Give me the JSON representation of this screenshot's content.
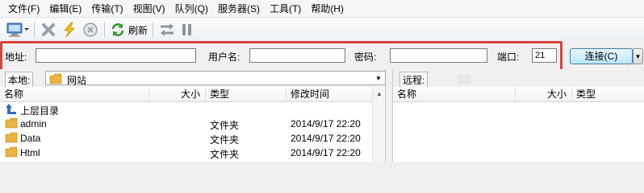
{
  "menu": [
    "文件(F)",
    "编辑(E)",
    "传输(T)",
    "视图(V)",
    "队列(Q)",
    "服务器(S)",
    "工具(T)",
    "帮助(H)"
  ],
  "toolbar": {
    "refresh_label": "刷新"
  },
  "connection": {
    "address_label": "地址:",
    "address_value": "",
    "username_label": "用户名:",
    "username_value": "",
    "password_label": "密码:",
    "password_value": "",
    "port_label": "端口:",
    "port_value": "21",
    "connect_label": "连接(C)",
    "highlight_color": "#d9433c"
  },
  "local": {
    "path_label": "本地:",
    "path_value": "网站",
    "columns": {
      "name": "名称",
      "size": "大小",
      "type": "类型",
      "modified": "修改时间"
    },
    "parent_dir": "上层目录",
    "rows": [
      {
        "name": "admin",
        "type": "文件夹",
        "modified": "2014/9/17 22:20"
      },
      {
        "name": "Data",
        "type": "文件夹",
        "modified": "2014/9/17 22:20"
      },
      {
        "name": "Html",
        "type": "文件夹",
        "modified": "2014/9/17 22:20"
      }
    ]
  },
  "remote": {
    "path_label": "远程:",
    "columns": {
      "name": "名称",
      "size": "大小",
      "type": "类型"
    }
  },
  "icons": {
    "folder_color": "#e8b341",
    "connect_icon": "computer-icon",
    "disconnect_icon": "disconnect-x-icon",
    "quick_icon": "lightning-icon",
    "stop_icon": "stop-icon",
    "refresh_icon": "refresh-icon",
    "transfer_icon": "transfer-icon",
    "pause_icon": "pause-icon"
  }
}
